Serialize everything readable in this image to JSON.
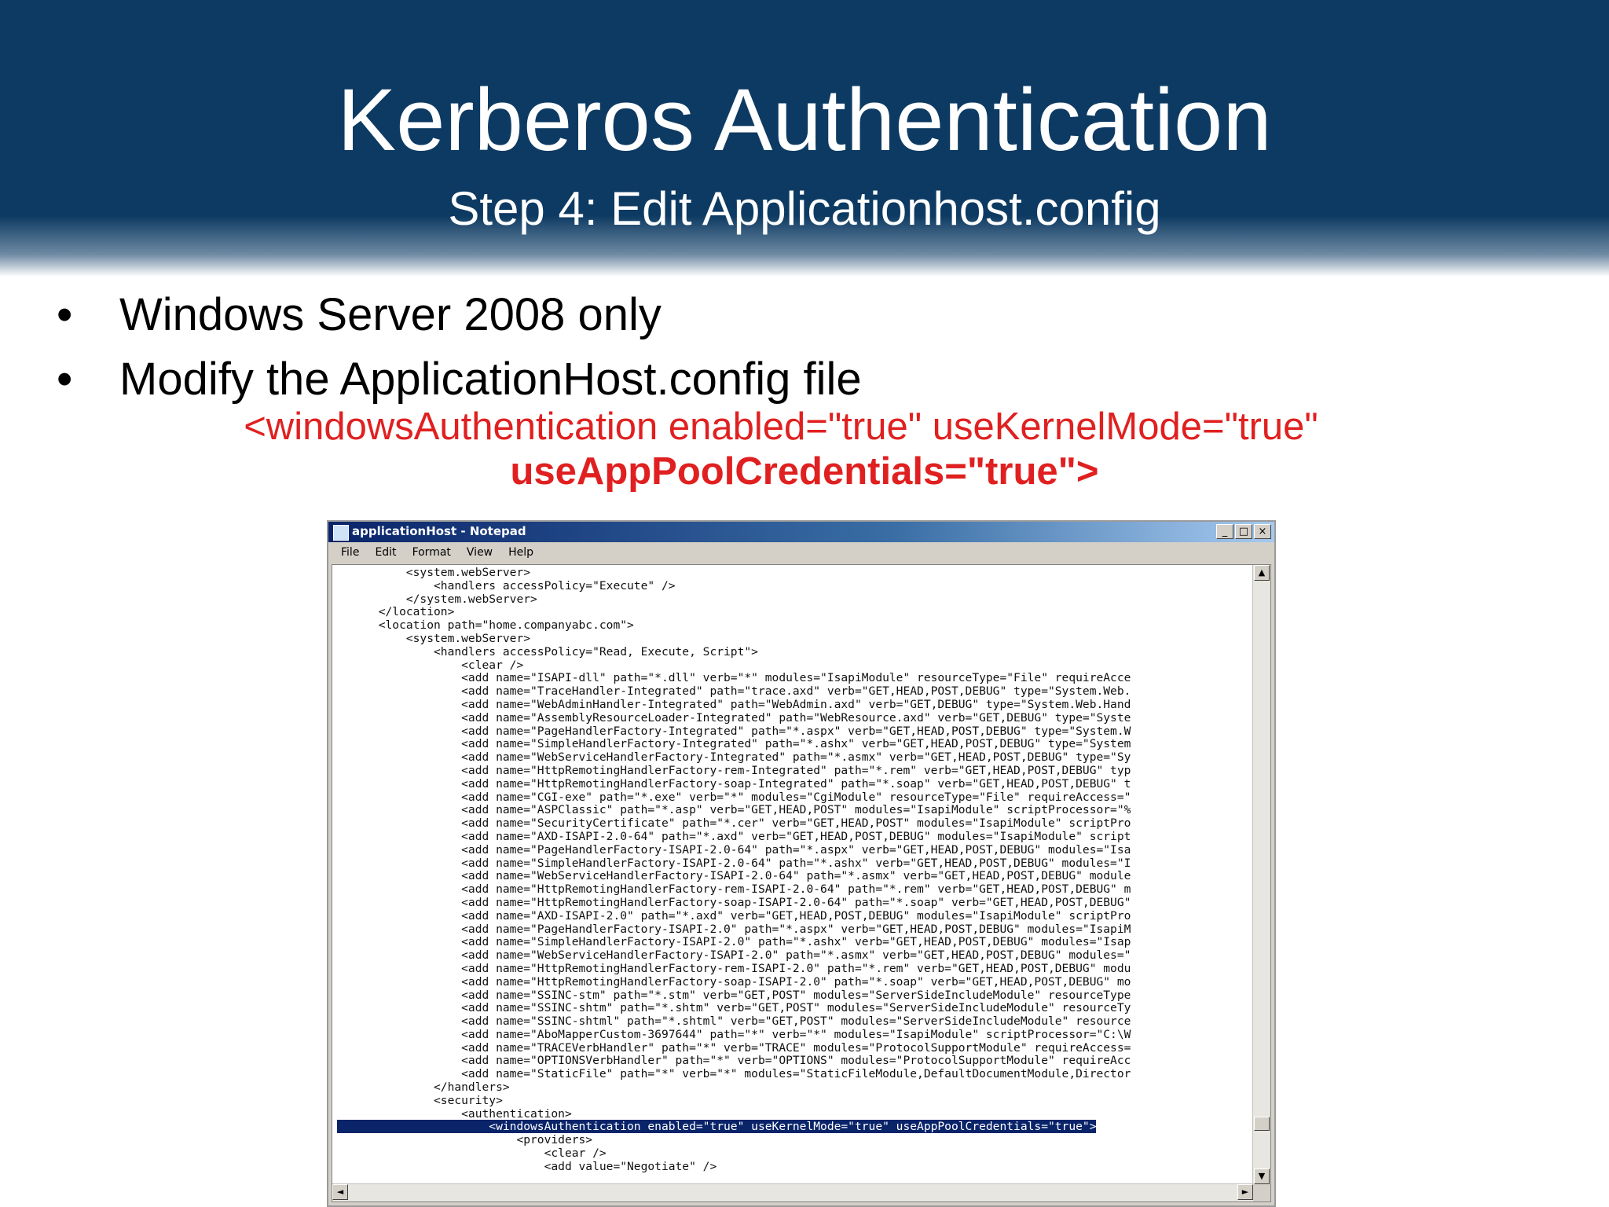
{
  "slide": {
    "title": "Kerberos Authentication",
    "subtitle": "Step 4: Edit Applicationhost.config",
    "bullets": [
      "Windows Server 2008 only",
      "Modify the ApplicationHost.config file"
    ],
    "bullet_symbol": "•",
    "code_line1": "<windowsAuthentication enabled=\"true\" useKernelMode=\"true\"",
    "code_line2": "useAppPoolCredentials=\"true\">",
    "colors": {
      "header_bg": "#0c3a63",
      "code_red": "#e02020",
      "selection": "#0a246a"
    }
  },
  "notepad": {
    "title": "applicationHost - Notepad",
    "window_buttons": {
      "minimize": "_",
      "maximize": "□",
      "close": "×"
    },
    "menu": [
      "File",
      "Edit",
      "Format",
      "View",
      "Help"
    ],
    "scroll_glyphs": {
      "up": "▲",
      "down": "▼",
      "left": "◄",
      "right": "►"
    },
    "lines": [
      "          <system.webServer>",
      "              <handlers accessPolicy=\"Execute\" />",
      "          </system.webServer>",
      "      </location>",
      "      <location path=\"home.companyabc.com\">",
      "          <system.webServer>",
      "              <handlers accessPolicy=\"Read, Execute, Script\">",
      "                  <clear />",
      "                  <add name=\"ISAPI-dll\" path=\"*.dll\" verb=\"*\" modules=\"IsapiModule\" resourceType=\"File\" requireAcce",
      "                  <add name=\"TraceHandler-Integrated\" path=\"trace.axd\" verb=\"GET,HEAD,POST,DEBUG\" type=\"System.Web.",
      "                  <add name=\"WebAdminHandler-Integrated\" path=\"WebAdmin.axd\" verb=\"GET,DEBUG\" type=\"System.Web.Hand",
      "                  <add name=\"AssemblyResourceLoader-Integrated\" path=\"WebResource.axd\" verb=\"GET,DEBUG\" type=\"Syste",
      "                  <add name=\"PageHandlerFactory-Integrated\" path=\"*.aspx\" verb=\"GET,HEAD,POST,DEBUG\" type=\"System.W",
      "                  <add name=\"SimpleHandlerFactory-Integrated\" path=\"*.ashx\" verb=\"GET,HEAD,POST,DEBUG\" type=\"System",
      "                  <add name=\"WebServiceHandlerFactory-Integrated\" path=\"*.asmx\" verb=\"GET,HEAD,POST,DEBUG\" type=\"Sy",
      "                  <add name=\"HttpRemotingHandlerFactory-rem-Integrated\" path=\"*.rem\" verb=\"GET,HEAD,POST,DEBUG\" typ",
      "                  <add name=\"HttpRemotingHandlerFactory-soap-Integrated\" path=\"*.soap\" verb=\"GET,HEAD,POST,DEBUG\" t",
      "                  <add name=\"CGI-exe\" path=\"*.exe\" verb=\"*\" modules=\"CgiModule\" resourceType=\"File\" requireAccess=\"",
      "                  <add name=\"ASPClassic\" path=\"*.asp\" verb=\"GET,HEAD,POST\" modules=\"IsapiModule\" scriptProcessor=\"%",
      "                  <add name=\"SecurityCertificate\" path=\"*.cer\" verb=\"GET,HEAD,POST\" modules=\"IsapiModule\" scriptPro",
      "                  <add name=\"AXD-ISAPI-2.0-64\" path=\"*.axd\" verb=\"GET,HEAD,POST,DEBUG\" modules=\"IsapiModule\" script",
      "                  <add name=\"PageHandlerFactory-ISAPI-2.0-64\" path=\"*.aspx\" verb=\"GET,HEAD,POST,DEBUG\" modules=\"Isa",
      "                  <add name=\"SimpleHandlerFactory-ISAPI-2.0-64\" path=\"*.ashx\" verb=\"GET,HEAD,POST,DEBUG\" modules=\"I",
      "                  <add name=\"WebServiceHandlerFactory-ISAPI-2.0-64\" path=\"*.asmx\" verb=\"GET,HEAD,POST,DEBUG\" module",
      "                  <add name=\"HttpRemotingHandlerFactory-rem-ISAPI-2.0-64\" path=\"*.rem\" verb=\"GET,HEAD,POST,DEBUG\" m",
      "                  <add name=\"HttpRemotingHandlerFactory-soap-ISAPI-2.0-64\" path=\"*.soap\" verb=\"GET,HEAD,POST,DEBUG\"",
      "                  <add name=\"AXD-ISAPI-2.0\" path=\"*.axd\" verb=\"GET,HEAD,POST,DEBUG\" modules=\"IsapiModule\" scriptPro",
      "                  <add name=\"PageHandlerFactory-ISAPI-2.0\" path=\"*.aspx\" verb=\"GET,HEAD,POST,DEBUG\" modules=\"IsapiM",
      "                  <add name=\"SimpleHandlerFactory-ISAPI-2.0\" path=\"*.ashx\" verb=\"GET,HEAD,POST,DEBUG\" modules=\"Isap",
      "                  <add name=\"WebServiceHandlerFactory-ISAPI-2.0\" path=\"*.asmx\" verb=\"GET,HEAD,POST,DEBUG\" modules=\"",
      "                  <add name=\"HttpRemotingHandlerFactory-rem-ISAPI-2.0\" path=\"*.rem\" verb=\"GET,HEAD,POST,DEBUG\" modu",
      "                  <add name=\"HttpRemotingHandlerFactory-soap-ISAPI-2.0\" path=\"*.soap\" verb=\"GET,HEAD,POST,DEBUG\" mo",
      "                  <add name=\"SSINC-stm\" path=\"*.stm\" verb=\"GET,POST\" modules=\"ServerSideIncludeModule\" resourceType",
      "                  <add name=\"SSINC-shtm\" path=\"*.shtm\" verb=\"GET,POST\" modules=\"ServerSideIncludeModule\" resourceTy",
      "                  <add name=\"SSINC-shtml\" path=\"*.shtml\" verb=\"GET,POST\" modules=\"ServerSideIncludeModule\" resource",
      "                  <add name=\"AboMapperCustom-3697644\" path=\"*\" verb=\"*\" modules=\"IsapiModule\" scriptProcessor=\"C:\\W",
      "                  <add name=\"TRACEVerbHandler\" path=\"*\" verb=\"TRACE\" modules=\"ProtocolSupportModule\" requireAccess=",
      "                  <add name=\"OPTIONSVerbHandler\" path=\"*\" verb=\"OPTIONS\" modules=\"ProtocolSupportModule\" requireAcc",
      "                  <add name=\"StaticFile\" path=\"*\" verb=\"*\" modules=\"StaticFileModule,DefaultDocumentModule,Director",
      "              </handlers>",
      "              <security>",
      "                  <authentication>",
      "                      <windowsAuthentication enabled=\"true\" useKernelMode=\"true\" useAppPoolCredentials=\"true\">",
      "                          <providers>",
      "                              <clear />",
      "                              <add value=\"Negotiate\" />"
    ]
  }
}
